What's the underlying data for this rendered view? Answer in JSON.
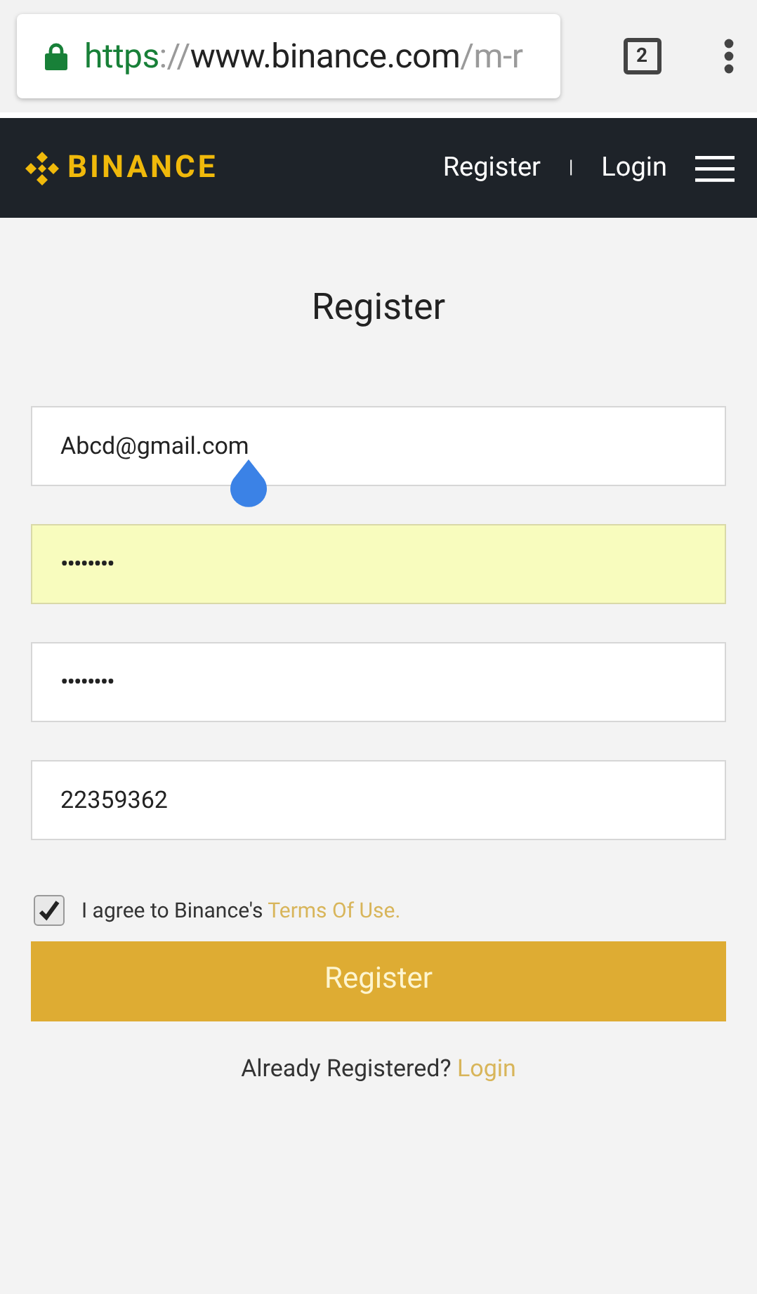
{
  "browser": {
    "url": {
      "scheme": "https",
      "separator": "://",
      "host": "www.binance.com",
      "path": "/m-r"
    },
    "tab_count": "2"
  },
  "header": {
    "logo": "BINANCE",
    "links": [
      {
        "label": "Register"
      },
      {
        "label": "Login"
      }
    ],
    "divider": "|"
  },
  "form": {
    "title": "Register",
    "fields": [
      {
        "kind": "text",
        "value": "Abcd@gmail.com",
        "autofilled": false,
        "cursor_handle": true
      },
      {
        "kind": "password",
        "value": "••••••••",
        "autofilled": true,
        "cursor_handle": false
      },
      {
        "kind": "password",
        "value": "••••••••",
        "autofilled": false,
        "cursor_handle": false
      },
      {
        "kind": "text",
        "value": "22359362",
        "autofilled": false,
        "cursor_handle": false
      }
    ],
    "agree": {
      "checked": true,
      "text": "I agree to Binance's",
      "link": "Terms Of Use."
    },
    "submit": "Register",
    "footer": {
      "text": "Already Registered?",
      "link": "Login"
    }
  }
}
